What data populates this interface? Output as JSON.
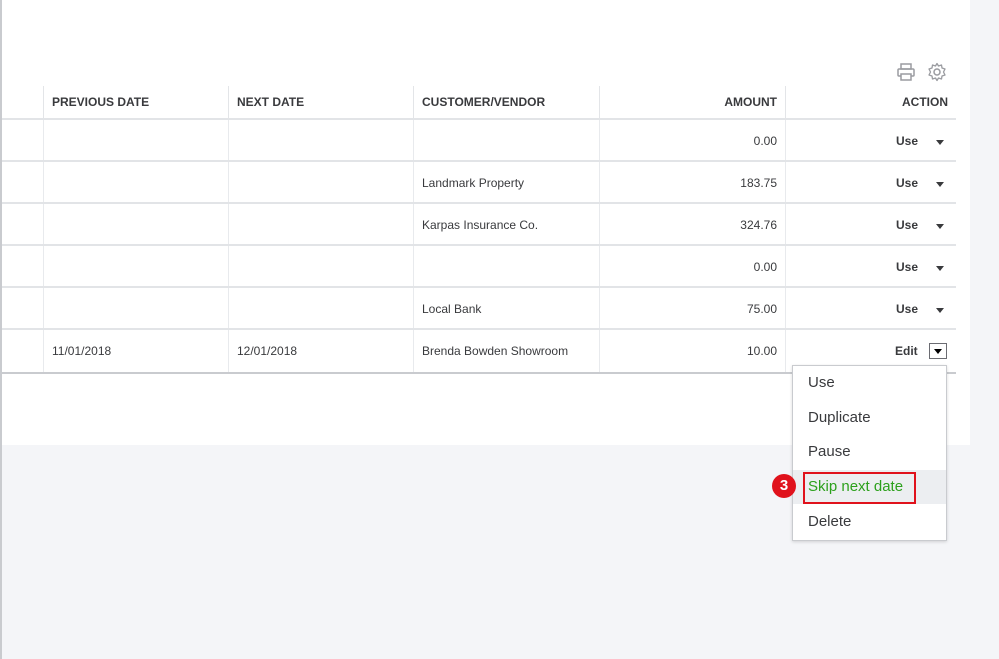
{
  "toolbar": {
    "print_icon": "print-icon",
    "settings_icon": "gear-icon"
  },
  "table": {
    "columns": {
      "previous_date": "PREVIOUS DATE",
      "next_date": "NEXT DATE",
      "customer_vendor": "CUSTOMER/VENDOR",
      "amount": "AMOUNT",
      "action": "ACTION"
    },
    "rows": [
      {
        "previous_date": "",
        "next_date": "",
        "customer_vendor": "",
        "amount": "0.00",
        "action": "Use"
      },
      {
        "previous_date": "",
        "next_date": "",
        "customer_vendor": "Landmark Property",
        "amount": "183.75",
        "action": "Use"
      },
      {
        "previous_date": "",
        "next_date": "",
        "customer_vendor": "Karpas Insurance Co.",
        "amount": "324.76",
        "action": "Use"
      },
      {
        "previous_date": "",
        "next_date": "",
        "customer_vendor": "",
        "amount": "0.00",
        "action": "Use"
      },
      {
        "previous_date": "",
        "next_date": "",
        "customer_vendor": "Local Bank",
        "amount": "75.00",
        "action": "Use"
      },
      {
        "previous_date": "11/01/2018",
        "next_date": "12/01/2018",
        "customer_vendor": "Brenda Bowden Showroom",
        "amount": "10.00",
        "action": "Edit"
      }
    ]
  },
  "action_menu": {
    "items": [
      "Use",
      "Duplicate",
      "Pause",
      "Skip next date",
      "Delete"
    ],
    "highlighted": "Skip next date"
  },
  "annotation": {
    "step": "3"
  },
  "colors": {
    "link": "#0077c5",
    "highlight_text": "#2ca01c",
    "annotation": "#e0121c"
  }
}
